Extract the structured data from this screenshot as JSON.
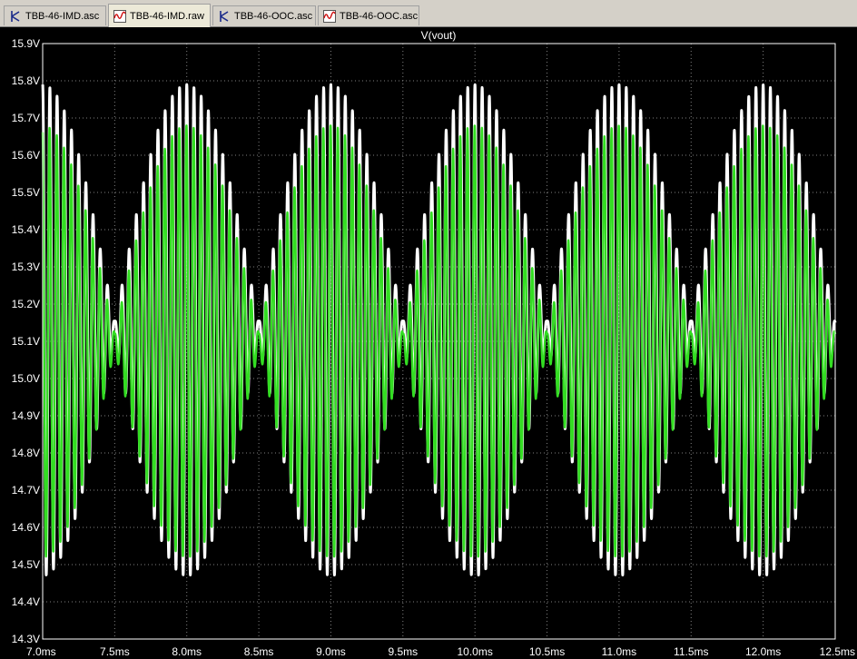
{
  "tabs": [
    {
      "label": "TBB-46-IMD.asc",
      "icon": "schematic-icon",
      "active": false
    },
    {
      "label": "TBB-46-IMD.raw",
      "icon": "waveform-icon",
      "active": true
    },
    {
      "label": "TBB-46-OOC.asc",
      "icon": "schematic-icon",
      "active": false
    },
    {
      "label": "TBB-46-OOC.asc",
      "icon": "waveform-icon",
      "active": false
    }
  ],
  "colors": {
    "background": "#000000",
    "grid": "#808080",
    "axis_text": "#ffffff",
    "trace_white": "#ffffff",
    "trace_green": "#33dd22",
    "tab_bar": "#d4d0c8"
  },
  "chart_data": {
    "type": "line",
    "title": "V(vout)",
    "x_unit": "ms",
    "y_unit": "V",
    "xlim": [
      7.0,
      12.5
    ],
    "ylim": [
      14.3,
      15.9
    ],
    "x_ticks": [
      "7.0ms",
      "7.5ms",
      "8.0ms",
      "8.5ms",
      "9.0ms",
      "9.5ms",
      "10.0ms",
      "10.5ms",
      "11.0ms",
      "11.5ms",
      "12.0ms",
      "12.5ms"
    ],
    "y_ticks": [
      "15.9V",
      "15.8V",
      "15.7V",
      "15.6V",
      "15.5V",
      "15.4V",
      "15.3V",
      "15.2V",
      "15.1V",
      "15.0V",
      "14.9V",
      "14.8V",
      "14.7V",
      "14.6V",
      "14.5V",
      "14.4V",
      "14.3V"
    ],
    "grid": true,
    "series": [
      {
        "color": "#ffffff",
        "center": 15.13,
        "envelope_max": 0.66,
        "envelope_min": 0.02,
        "envelope_period_ms": 1.0,
        "envelope_peaks_ms": [
          7.0,
          8.0,
          9.0,
          10.0,
          11.0,
          12.0
        ],
        "carrier_period_ms": 0.05
      },
      {
        "color": "#33dd22",
        "center": 15.1,
        "envelope_max": 0.58,
        "envelope_min": 0.02,
        "envelope_period_ms": 1.0,
        "envelope_peaks_ms": [
          7.0,
          8.0,
          9.0,
          10.0,
          11.0,
          12.0
        ],
        "carrier_period_ms": 0.05
      }
    ]
  }
}
